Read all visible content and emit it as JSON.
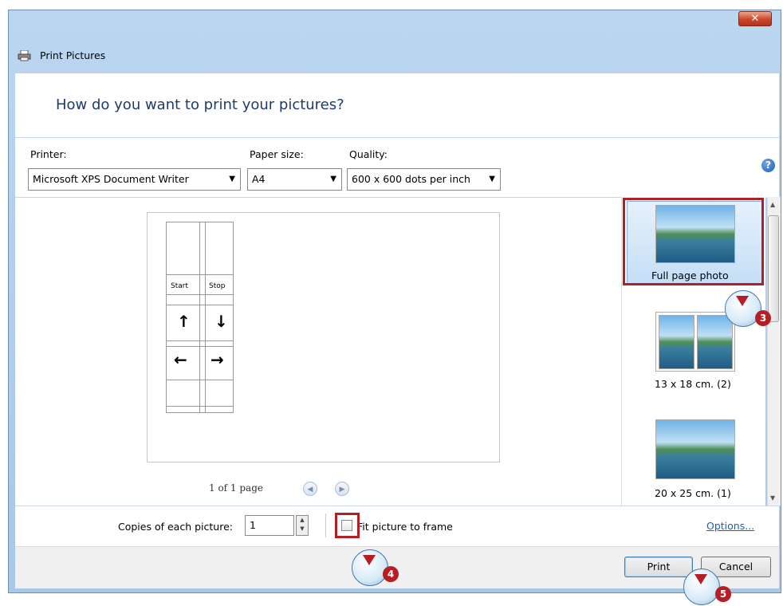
{
  "window": {
    "title": "Print Pictures",
    "close_glyph": "✕"
  },
  "header": {
    "heading": "How do you want to print your pictures?"
  },
  "options": {
    "printer_label": "Printer:",
    "printer_value": "Microsoft XPS Document Writer",
    "paper_label": "Paper size:",
    "paper_value": "A4",
    "quality_label": "Quality:",
    "quality_value": "600 x 600 dots per inch",
    "help_glyph": "?"
  },
  "preview": {
    "sheet_start": "Start",
    "sheet_stop": "Stop",
    "page_count": "1 of 1 page",
    "prev_glyph": "◀",
    "next_glyph": "▶"
  },
  "layouts": [
    {
      "label": "Full page photo",
      "selected": true
    },
    {
      "label": "13 x 18 cm. (2)",
      "selected": false
    },
    {
      "label": "20 x 25 cm. (1)",
      "selected": false
    }
  ],
  "copies": {
    "label": "Copies of each picture:",
    "value": "1"
  },
  "fit": {
    "label": "Fit picture to frame",
    "checked": false
  },
  "options_link": "Options...",
  "buttons": {
    "print": "Print",
    "cancel": "Cancel"
  },
  "annotations": {
    "step3": "3",
    "step4": "4",
    "step5": "5",
    "highlight_color": "#b61e24"
  }
}
